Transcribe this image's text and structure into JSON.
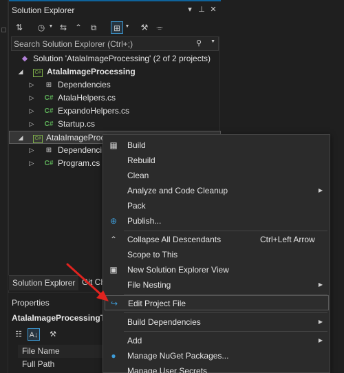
{
  "panel": {
    "title": "Solution Explorer",
    "title_buttons": [
      "chevron-down-icon",
      "pin-icon",
      "close-icon"
    ]
  },
  "search": {
    "placeholder": "Search Solution Explorer (Ctrl+;)"
  },
  "tree": {
    "solution": "Solution 'AtalaImageProcessing' (2 of 2 projects)",
    "project1": "AtalaImageProcessing",
    "dependencies1": "Dependencies",
    "file1": "AtalaHelpers.cs",
    "file2": "ExpandoHelpers.cs",
    "file3": "Startup.cs",
    "project2": "AtalaImageProc",
    "dependencies2": "Dependenci",
    "file4": "Program.cs"
  },
  "bottom_tabs": {
    "tab1": "Solution Explorer",
    "tab2": "Git Ch"
  },
  "properties": {
    "title": "Properties",
    "object": "AtalaImageProcessingTe",
    "rows": [
      "File Name",
      "Full Path"
    ]
  },
  "context_menu": {
    "build": "Build",
    "rebuild": "Rebuild",
    "clean": "Clean",
    "analyze": "Analyze and Code Cleanup",
    "pack": "Pack",
    "publish": "Publish...",
    "collapse": "Collapse All Descendants",
    "collapse_shortcut": "Ctrl+Left Arrow",
    "scope": "Scope to This",
    "new_view": "New Solution Explorer View",
    "file_nesting": "File Nesting",
    "edit_project": "Edit Project File",
    "build_deps": "Build Dependencies",
    "add": "Add",
    "nuget": "Manage NuGet Packages...",
    "user_secrets": "Manage User Secrets"
  },
  "colors": {
    "accent": "#0e639c",
    "menu_bg": "#2b2b2b",
    "panel_bg": "#1f1f1f",
    "csharp_green": "#5fb35a",
    "annotation_arrow": "#e0231f"
  }
}
